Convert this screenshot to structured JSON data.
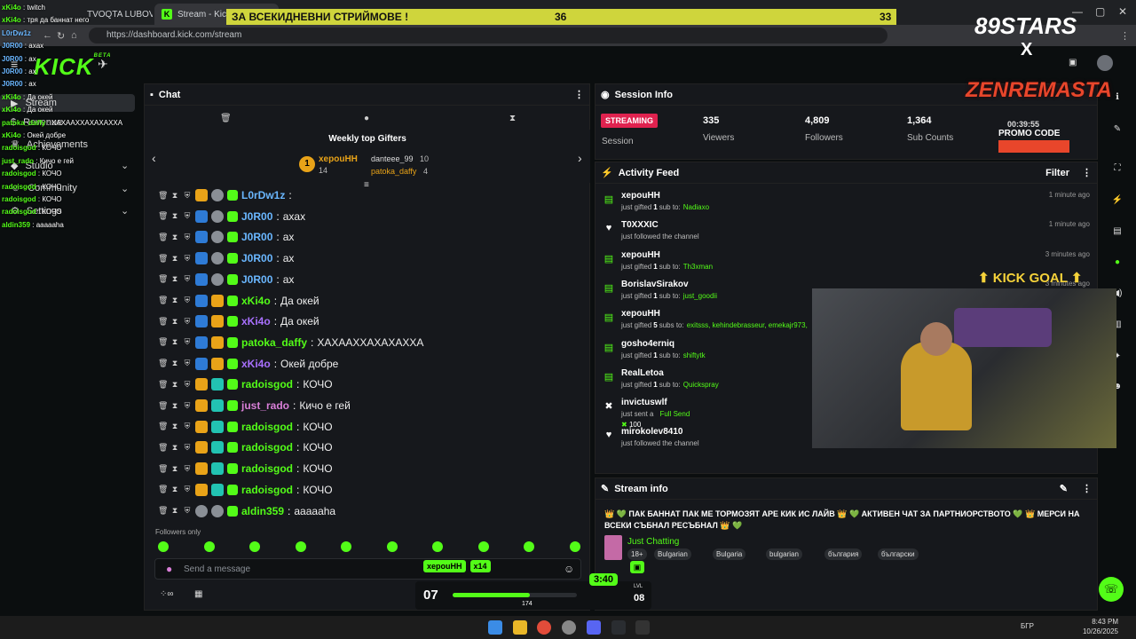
{
  "browser": {
    "tab1_title": "TVOQTA LUBOV",
    "tab2_title": "Stream - Kick Das",
    "tab3_title": "...",
    "url": "https://dashboard.kick.com/stream"
  },
  "banner": {
    "text": "ЗА ВСЕКИДНЕВНИ СТРИЙМОВЕ !",
    "n1": "36",
    "n2": "33"
  },
  "overlay": {
    "brand": "89STARS",
    "brand_sub": "X",
    "zenre": "ZENREMASTA",
    "promo": "PROMO CODE",
    "timer_top": "00:39:55",
    "goal": "KICK GOAL"
  },
  "overlay_chat": [
    {
      "user": "xKi4o",
      "msg": "twitch",
      "color": "#53fc18"
    },
    {
      "user": "xKi4o",
      "msg": "тря да баннат него",
      "color": "#53fc18"
    },
    {
      "user": "L0rDw1z",
      "msg": "",
      "color": "#6ab7ff"
    },
    {
      "user": "J0R00",
      "msg": "axax",
      "color": "#6ab7ff"
    },
    {
      "user": "J0R00",
      "msg": "ax",
      "color": "#6ab7ff"
    },
    {
      "user": "J0R00",
      "msg": "ax",
      "color": "#6ab7ff"
    },
    {
      "user": "J0R00",
      "msg": "ax",
      "color": "#6ab7ff"
    },
    {
      "user": "xKi4o",
      "msg": "Да окей",
      "color": "#53fc18"
    },
    {
      "user": "xKi4o",
      "msg": "Да окей",
      "color": "#53fc18"
    },
    {
      "user": "patoka_daffy",
      "msg": "ХАХААХХАХАХАХХА",
      "color": "#53fc18"
    },
    {
      "user": "xKi4o",
      "msg": "Окей добре",
      "color": "#53fc18"
    },
    {
      "user": "radoisgod",
      "msg": "КОЧО",
      "color": "#53fc18"
    },
    {
      "user": "just_rado",
      "msg": "Кичо е гей",
      "color": "#53fc18"
    },
    {
      "user": "radoisgod",
      "msg": "КОЧО",
      "color": "#53fc18"
    },
    {
      "user": "radoisgod",
      "msg": "КОЧО",
      "color": "#53fc18"
    },
    {
      "user": "radoisgod",
      "msg": "КОЧО",
      "color": "#53fc18"
    },
    {
      "user": "radoisgod",
      "msg": "КОЧО",
      "color": "#53fc18"
    },
    {
      "user": "aldin359",
      "msg": "aaaaaha",
      "color": "#53fc18"
    }
  ],
  "sidebar": {
    "items": [
      {
        "label": "Stream"
      },
      {
        "label": "Revenue"
      },
      {
        "label": "Achievements"
      },
      {
        "label": "Studio"
      },
      {
        "label": "Community"
      },
      {
        "label": "Settings"
      }
    ]
  },
  "chat": {
    "title": "Chat",
    "weekly_title": "Weekly top Gifters",
    "top1": {
      "name": "xepouHH",
      "count": "14"
    },
    "top2": {
      "name": "danteee_99",
      "count": "10"
    },
    "top3": {
      "name": "patoka_daffy",
      "count": "4"
    },
    "messages": [
      {
        "user": "L0rDw1z",
        "msg": "",
        "color": "#6ab7ff"
      },
      {
        "user": "J0R00",
        "msg": "axax",
        "color": "#6ab7ff"
      },
      {
        "user": "J0R00",
        "msg": "ax",
        "color": "#6ab7ff"
      },
      {
        "user": "J0R00",
        "msg": "ax",
        "color": "#6ab7ff"
      },
      {
        "user": "J0R00",
        "msg": "ax",
        "color": "#6ab7ff"
      },
      {
        "user": "xKi4o",
        "msg": "Да окей",
        "color": "#53fc18"
      },
      {
        "user": "xKi4o",
        "msg": "Да окей",
        "color": "#a970ff"
      },
      {
        "user": "patoka_daffy",
        "msg": "ХАХААХХАХАХАХХА",
        "color": "#53fc18"
      },
      {
        "user": "xKi4o",
        "msg": "Окей добре",
        "color": "#a970ff"
      },
      {
        "user": "radoisgod",
        "msg": "КОЧО",
        "color": "#53fc18"
      },
      {
        "user": "just_rado",
        "msg": "Кичо е гей",
        "color": "#d97fd8"
      },
      {
        "user": "radoisgod",
        "msg": "КОЧО",
        "color": "#53fc18"
      },
      {
        "user": "radoisgod",
        "msg": "КОЧО",
        "color": "#53fc18"
      },
      {
        "user": "radoisgod",
        "msg": "КОЧО",
        "color": "#53fc18"
      },
      {
        "user": "radoisgod",
        "msg": "КОЧО",
        "color": "#53fc18"
      },
      {
        "user": "aldin359",
        "msg": "aaaaaha",
        "color": "#53fc18"
      }
    ],
    "followers_only": "Followers only",
    "input_placeholder": "Send a message"
  },
  "session": {
    "title": "Session Info",
    "status": "STREAMING",
    "session_label": "Session",
    "viewers": "335",
    "viewers_label": "Viewers",
    "followers": "4,809",
    "followers_label": "Followers",
    "subs": "1,364",
    "subs_label": "Sub Counts"
  },
  "activity": {
    "title": "Activity Feed",
    "filter": "Filter",
    "items": [
      {
        "user": "xepouHH",
        "pre": "just gifted",
        "count": "1",
        "mid": "sub to:",
        "target": "Nadiaxo",
        "time": "1 minute ago",
        "icon": "gift-icon"
      },
      {
        "user": "T0XXXIC",
        "pre": "just followed the channel",
        "count": "",
        "mid": "",
        "target": "",
        "time": "1 minute ago",
        "icon": "heart-icon"
      },
      {
        "user": "xepouHH",
        "pre": "just gifted",
        "count": "1",
        "mid": "sub to:",
        "target": "Th3xman",
        "time": "3 minutes ago",
        "icon": "gift-icon"
      },
      {
        "user": "BorislavSirakov",
        "pre": "just gifted",
        "count": "1",
        "mid": "sub to:",
        "target": "just_goodii",
        "time": "3 minutes ago",
        "icon": "gift-icon"
      },
      {
        "user": "xepouHH",
        "pre": "just gifted",
        "count": "5",
        "mid": "subs to:",
        "target": "exitsss, kehindebrasseur, emekajr973,",
        "time": "",
        "icon": "gift-icon"
      },
      {
        "user": "gosho4erniq",
        "pre": "just gifted",
        "count": "1",
        "mid": "sub to:",
        "target": "shiftytk",
        "time": "",
        "icon": "gift-icon"
      },
      {
        "user": "RealLetoa",
        "pre": "just gifted",
        "count": "1",
        "mid": "sub to:",
        "target": "Quickspray",
        "time": "",
        "icon": "gift-icon"
      },
      {
        "user": "invictuswlf",
        "pre": "just sent a",
        "count": "",
        "mid": "",
        "target": "Full Send",
        "time": "",
        "icon": "kick-icon",
        "amount": "100"
      },
      {
        "user": "mirokolev8410",
        "pre": "just followed the channel",
        "count": "",
        "mid": "",
        "target": "",
        "time": "",
        "icon": "heart-icon"
      }
    ]
  },
  "stream_info": {
    "title": "Stream info",
    "description": "👑 💚 ПАК БАННАТ ПАК МЕ ТОРМОЗЯТ АРЕ КИК ИС ЛАЙВ 👑 💚 АКТИВЕН ЧАТ ЗА ПАРТНИОРСТВОТО 💚 👑 МЕРСИ НА ВСЕКИ СЪБНАЛ РЕСЪБНАЛ 👑 💚",
    "category": "Just Chatting",
    "tags": [
      "18+",
      "Bulgarian",
      "Bulgaria",
      "bulgarian",
      "българия",
      "български"
    ]
  },
  "gift_overlay": {
    "name": "xepouHH",
    "count": "x14"
  },
  "level": {
    "left": "07",
    "right": "08",
    "lvl": "LVL",
    "timer": "3:40",
    "value": "174",
    "progress": 0.62
  },
  "taskbar": {
    "lang": "БГР",
    "time": "8:43 PM",
    "date": "10/26/2025"
  },
  "colors": {
    "kick_green": "#53fc18",
    "streaming_red": "#e0224f",
    "banner_yellow": "#cfd53c"
  }
}
